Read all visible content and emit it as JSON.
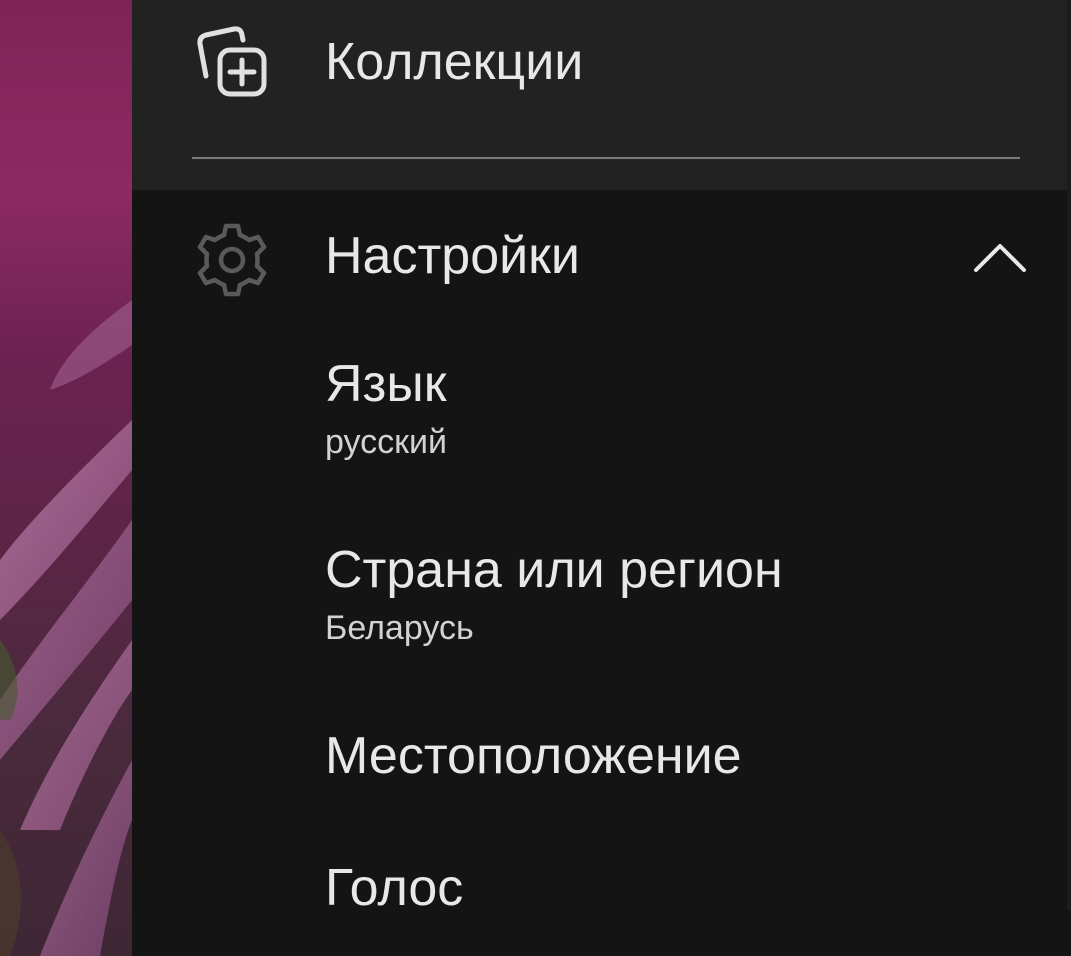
{
  "colors": {
    "panel_bg": "#141414",
    "collections_bg": "#222222",
    "text_primary": "#e8e8e8",
    "text_secondary": "#d2d2d2",
    "divider": "#7a7a7a",
    "icon_collections": "#e0e0e0",
    "icon_settings": "#5a5a5a"
  },
  "menu": {
    "collections": {
      "label": "Коллекции",
      "icon": "collections-add-icon"
    },
    "settings": {
      "label": "Настройки",
      "icon": "gear-icon",
      "expanded": true,
      "toggle_icon": "chevron-up-icon",
      "items": [
        {
          "title": "Язык",
          "value": "русский"
        },
        {
          "title": "Страна или регион",
          "value": "Беларусь"
        },
        {
          "title": "Местоположение"
        },
        {
          "title": "Голос"
        }
      ]
    }
  }
}
